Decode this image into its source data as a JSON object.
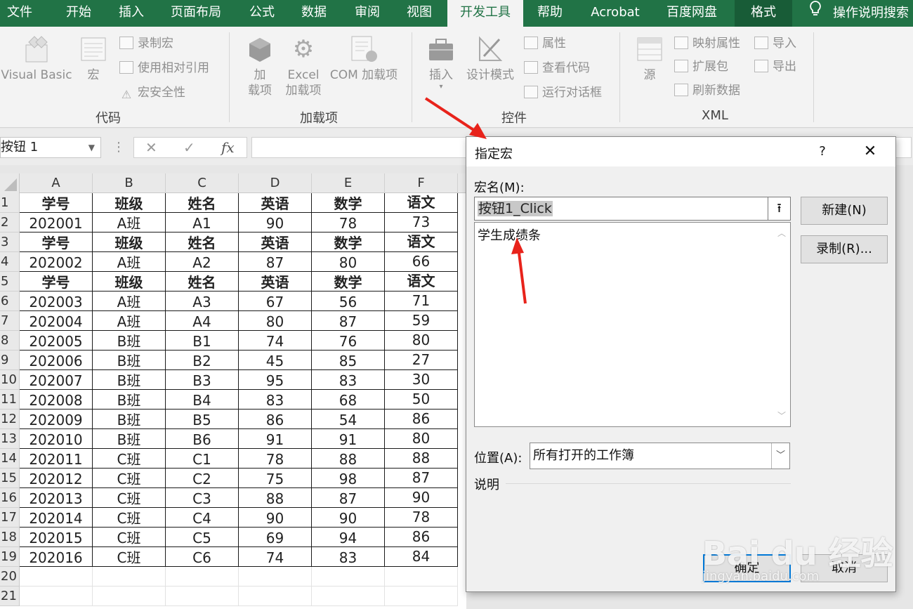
{
  "ribbon": {
    "tabs": [
      "文件",
      "开始",
      "插入",
      "页面布局",
      "公式",
      "数据",
      "审阅",
      "视图",
      "开发工具",
      "帮助",
      "Acrobat",
      "百度网盘",
      "格式"
    ],
    "active_tab": "开发工具",
    "tell_me": "操作说明搜索",
    "groups": {
      "code": {
        "label": "代码",
        "visual_basic": "Visual Basic",
        "macros": "宏",
        "record_macro": "录制宏",
        "relative_refs": "使用相对引用",
        "macro_security": "宏安全性"
      },
      "addins": {
        "label": "加载项",
        "addins_line1": "加",
        "addins_line2": "载项",
        "excel_addins_line1": "Excel",
        "excel_addins_line2": "加载项",
        "com_addins": "COM 加载项"
      },
      "controls": {
        "label": "控件",
        "insert": "插入",
        "design_mode": "设计模式",
        "properties": "属性",
        "view_code": "查看代码",
        "run_dialog": "运行对话框"
      },
      "xml": {
        "label": "XML",
        "source": "源",
        "map_properties": "映射属性",
        "expansion_packs": "扩展包",
        "refresh_data": "刷新数据",
        "import": "导入",
        "export": "导出"
      }
    }
  },
  "formula_bar": {
    "name_box": "按钮 1",
    "cancel_icon": "✕",
    "enter_icon": "✓",
    "fx": "fx",
    "formula": ""
  },
  "sheet": {
    "columns": [
      "A",
      "B",
      "C",
      "D",
      "E",
      "F"
    ],
    "row_numbers": [
      "1",
      "2",
      "3",
      "4",
      "5",
      "6",
      "7",
      "8",
      "9",
      "10",
      "11",
      "12",
      "13",
      "14",
      "15",
      "16",
      "17",
      "18",
      "19",
      "20",
      "21"
    ],
    "rows": [
      [
        "学号",
        "班级",
        "姓名",
        "英语",
        "数学",
        "语文"
      ],
      [
        "202001",
        "A班",
        "A1",
        "90",
        "78",
        "73"
      ],
      [
        "学号",
        "班级",
        "姓名",
        "英语",
        "数学",
        "语文"
      ],
      [
        "202002",
        "A班",
        "A2",
        "87",
        "80",
        "66"
      ],
      [
        "学号",
        "班级",
        "姓名",
        "英语",
        "数学",
        "语文"
      ],
      [
        "202003",
        "A班",
        "A3",
        "67",
        "56",
        "71"
      ],
      [
        "202004",
        "A班",
        "A4",
        "80",
        "87",
        "59"
      ],
      [
        "202005",
        "B班",
        "B1",
        "74",
        "76",
        "80"
      ],
      [
        "202006",
        "B班",
        "B2",
        "45",
        "85",
        "27"
      ],
      [
        "202007",
        "B班",
        "B3",
        "95",
        "83",
        "30"
      ],
      [
        "202008",
        "B班",
        "B4",
        "83",
        "68",
        "50"
      ],
      [
        "202009",
        "B班",
        "B5",
        "86",
        "54",
        "86"
      ],
      [
        "202010",
        "B班",
        "B6",
        "91",
        "91",
        "80"
      ],
      [
        "202011",
        "C班",
        "C1",
        "78",
        "88",
        "88"
      ],
      [
        "202012",
        "C班",
        "C2",
        "75",
        "98",
        "87"
      ],
      [
        "202013",
        "C班",
        "C3",
        "88",
        "87",
        "90"
      ],
      [
        "202014",
        "C班",
        "C4",
        "90",
        "90",
        "78"
      ],
      [
        "202015",
        "C班",
        "C5",
        "69",
        "94",
        "86"
      ],
      [
        "202016",
        "C班",
        "C6",
        "74",
        "83",
        "84"
      ]
    ]
  },
  "dialog": {
    "title": "指定宏",
    "help": "?",
    "close": "✕",
    "macro_name_label": "宏名(M):",
    "macro_name_value": "按钮1_Click",
    "macro_list": [
      "学生成绩条"
    ],
    "new_button": "新建(N)",
    "record_button": "录制(R)...",
    "location_label": "位置(A):",
    "location_value": "所有打开的工作簿",
    "description_label": "说明",
    "ok_button": "确定",
    "cancel_button": "取消"
  },
  "watermark": {
    "brand": "Bai du 经验",
    "url": "jingyan.baidu.com"
  },
  "colors": {
    "excel_green": "#217346",
    "annotation_red": "#e8231b",
    "default_button_border": "#0078d7"
  }
}
